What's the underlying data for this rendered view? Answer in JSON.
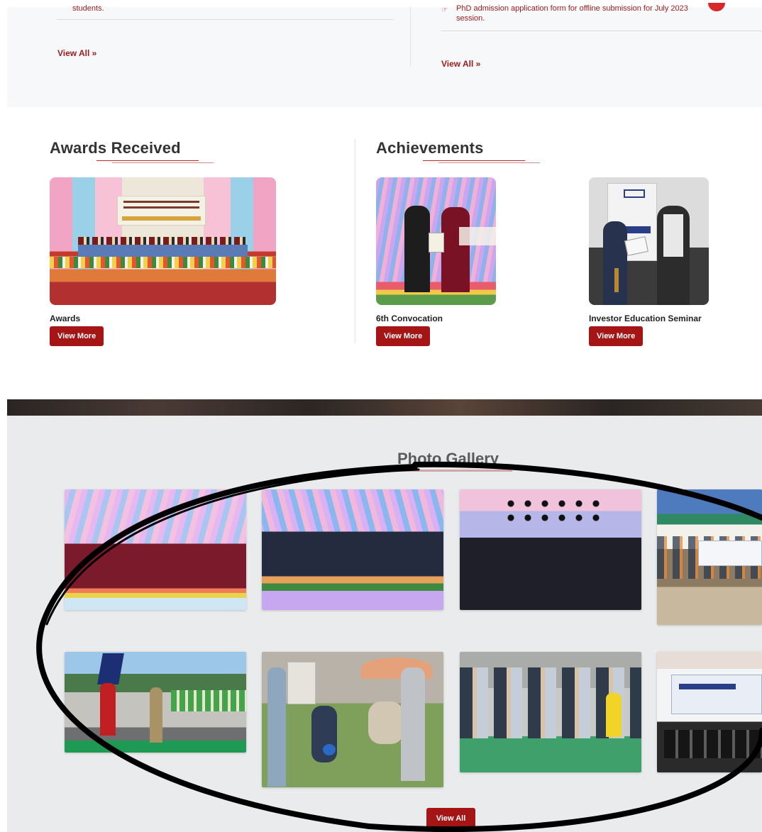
{
  "notices": {
    "left": {
      "text": "students.",
      "view_all": "View All »"
    },
    "right": {
      "icon": "hand-point-icon",
      "text": "PhD admission application form for offline submission for July 2023 session.",
      "view_all": "View All »"
    }
  },
  "awards": {
    "title": "Awards Received",
    "cards": [
      {
        "caption": "Awards",
        "button": "View More"
      }
    ]
  },
  "achievements": {
    "title": "Achievements",
    "cards": [
      {
        "caption": "6th Convocation",
        "button": "View More"
      },
      {
        "caption": "Investor Education Seminar",
        "button": "View More"
      }
    ]
  },
  "gallery": {
    "title": "Photo Gallery",
    "view_all": "View All"
  },
  "colors": {
    "brand_red": "#a51515",
    "link_red": "#9c1c1c",
    "section_bg": "#f7f8f9",
    "gallery_bg": "#e9ebec",
    "annotation": "#000000"
  }
}
